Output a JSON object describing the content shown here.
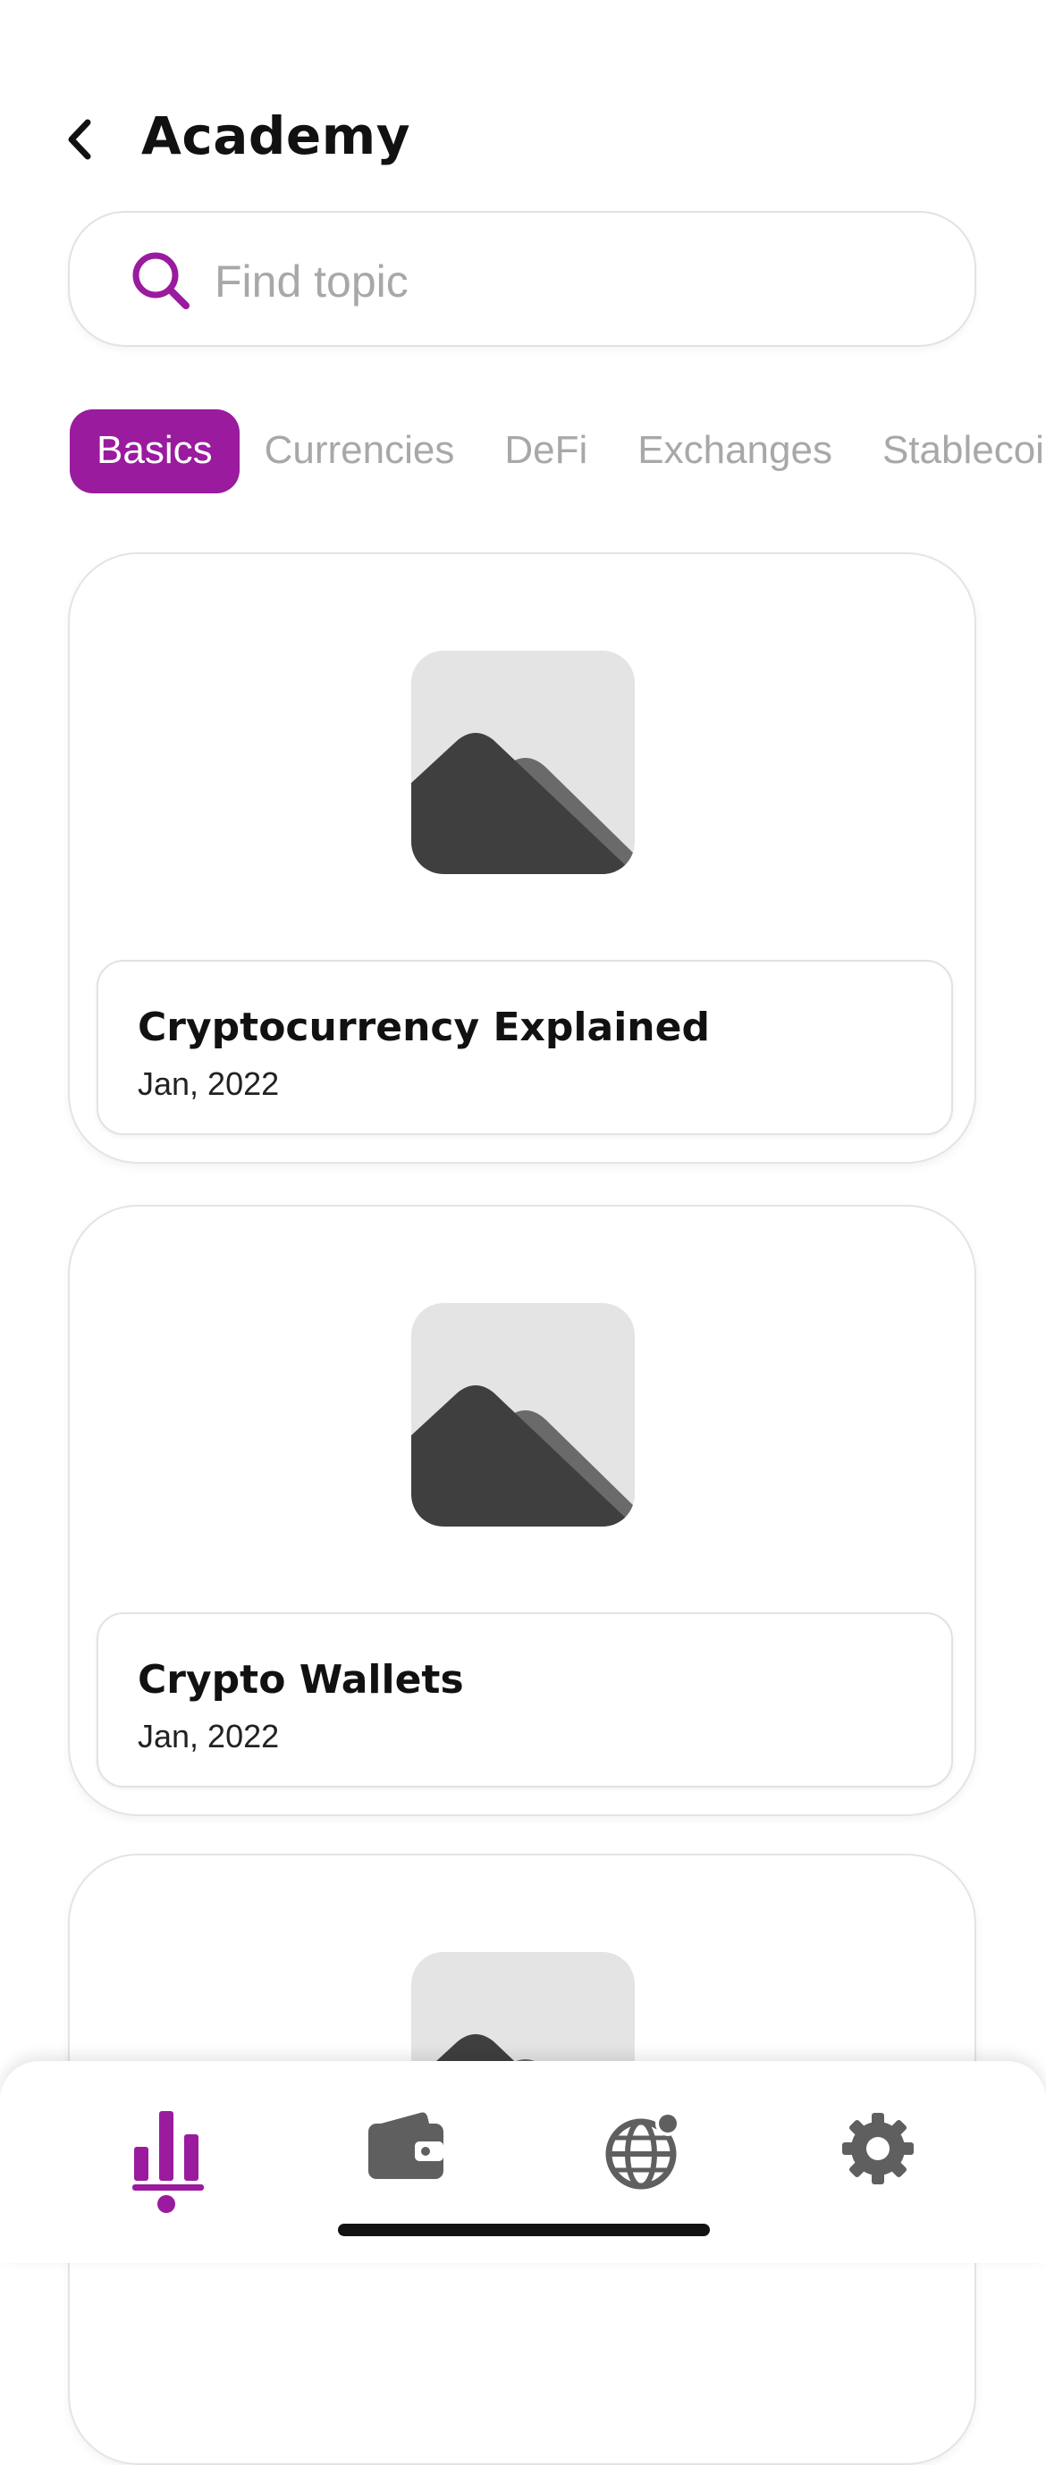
{
  "header": {
    "title": "Academy"
  },
  "search": {
    "placeholder": "Find topic",
    "value": ""
  },
  "tabs": [
    {
      "label": "Basics",
      "active": true
    },
    {
      "label": "Currencies",
      "active": false
    },
    {
      "label": "DeFi",
      "active": false
    },
    {
      "label": "Exchanges",
      "active": false
    },
    {
      "label": "Stablecoins",
      "active": false
    }
  ],
  "articles": [
    {
      "title": "Cryptocurrency Explained",
      "date": "Jan, 2022"
    },
    {
      "title": "Crypto Wallets",
      "date": "Jan, 2022"
    }
  ],
  "bottom_nav": {
    "items": [
      {
        "icon": "chart-icon",
        "active": true
      },
      {
        "icon": "wallet-icon",
        "active": false
      },
      {
        "icon": "globe-icon",
        "active": false,
        "has_badge": true
      },
      {
        "icon": "gear-icon",
        "active": false
      }
    ]
  },
  "colors": {
    "accent": "#9a1b9e",
    "icon_gray": "#5f5f5f",
    "placeholder": "#a8a8a8",
    "image_bg": "#e4e4e4",
    "image_dark": "#3f3f3f",
    "image_mid": "#6a6a6a"
  }
}
